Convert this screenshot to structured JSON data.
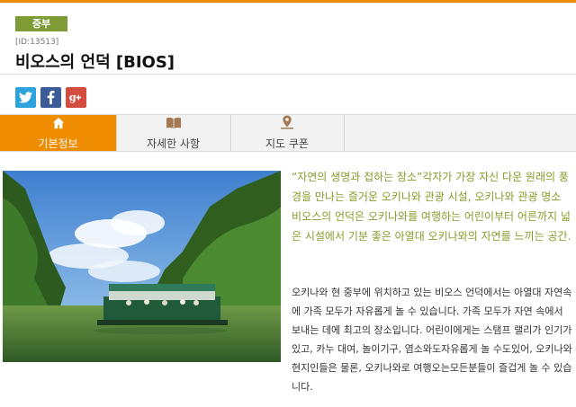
{
  "header": {
    "region_badge": "중부",
    "id_label": "[ID:13513]",
    "title": "비오스의 언덕 [BIOS]"
  },
  "social": {
    "twitter_icon": "twitter-icon",
    "facebook_icon": "facebook-icon",
    "googleplus_icon": "google-plus-icon"
  },
  "tabs": [
    {
      "label": "기본정보",
      "icon": "home-icon",
      "active": true
    },
    {
      "label": "자세한 사항",
      "icon": "book-icon",
      "active": false
    },
    {
      "label": "지도 쿠폰",
      "icon": "map-pin-icon",
      "active": false
    }
  ],
  "content": {
    "quote": "“자연의 생명과 접하는 장소”각자가 가장 자신 다운 원래의 풍경을 만나는 즐거운 오키나와 관광 시설, 오키나와 관광 명소 비오스의 언덕은 오키나와를 여행하는 어린이부터 어른까지 넓은 시설에서 기분 좋은 아열대 오키나와의 자연를 느끼는 공간.",
    "body": "오키나와 현 중부에 위치하고 있는 비오스 언덕에서는 아열대 자연속에 가족 모두가 자유롭게 놀 수 있습니다. 가족 모두가 자연 속에서 보내는 데에 최고의 장소입니다. 어린이에게는 스탬프 랠리가 인기가 있고, 카누 대여, 놀이기구, 염소와도자유롭게 놀 수도있어, 오키나와 현지인들은 물론, 오키나와로 여행오는모든분들이 즐겁게 놀 수 있습니다."
  },
  "colors": {
    "accent": "#f08c00",
    "badge": "#7f9b35",
    "quote_text": "#8a9a2a"
  }
}
